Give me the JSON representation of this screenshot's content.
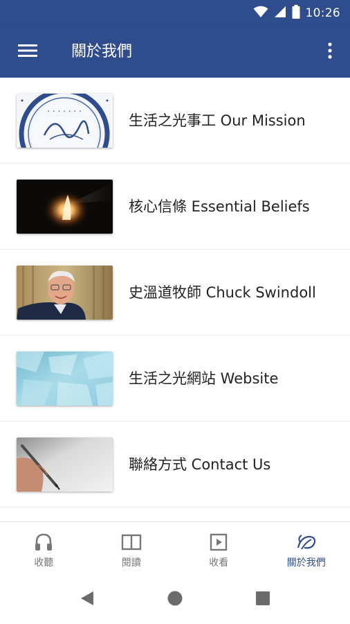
{
  "status_bar": {
    "time": "10:26",
    "icons": [
      "wifi-icon",
      "cellular-signal-icon",
      "battery-icon"
    ]
  },
  "app_bar": {
    "title": "關於我們",
    "menu_icon": "hamburger-menu-icon",
    "overflow_icon": "more-vertical-icon"
  },
  "list": {
    "items": [
      {
        "label": "生活之光事工 Our Mission",
        "thumbnail": "mission-seal"
      },
      {
        "label": "核心信條 Essential Beliefs",
        "thumbnail": "light-in-darkness"
      },
      {
        "label": "史溫道牧師 Chuck Swindoll",
        "thumbnail": "pastor-portrait"
      },
      {
        "label": "生活之光網站 Website",
        "thumbnail": "blue-ice-texture"
      },
      {
        "label": "聯絡方式 Contact Us",
        "thumbnail": "hand-writing-pen"
      }
    ]
  },
  "bottom_nav": {
    "items": [
      {
        "label": "收聽",
        "icon": "headphones-icon",
        "active": false
      },
      {
        "label": "閱讀",
        "icon": "book-icon",
        "active": false
      },
      {
        "label": "收看",
        "icon": "play-icon",
        "active": false
      },
      {
        "label": "關於我們",
        "icon": "leaf-logo-icon",
        "active": true
      }
    ]
  },
  "system_nav": {
    "buttons": [
      "back-icon",
      "home-icon",
      "recents-icon"
    ]
  },
  "colors": {
    "primary": "#2f4d8c",
    "inactive": "#777777",
    "text": "#222222"
  }
}
